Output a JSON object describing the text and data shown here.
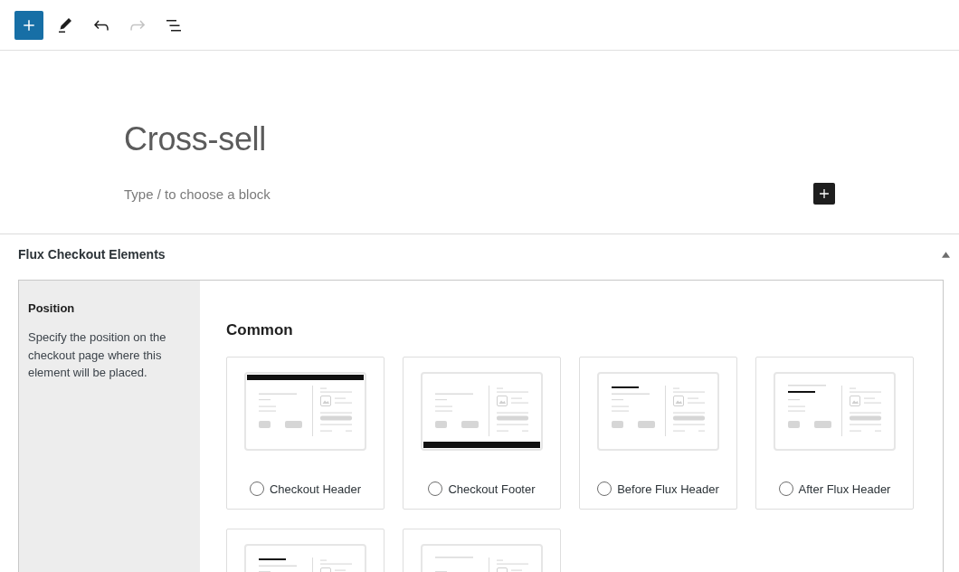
{
  "toolbar": [
    {
      "kind": "add",
      "disabled": false
    },
    {
      "kind": "edit",
      "disabled": false
    },
    {
      "kind": "undo",
      "disabled": false
    },
    {
      "kind": "redo",
      "disabled": true
    },
    {
      "kind": "list",
      "disabled": false
    }
  ],
  "editor": {
    "title": "Cross-sell",
    "placeholder": "Type / to choose a block"
  },
  "metabox": {
    "title": "Flux Checkout Elements",
    "expanded": true,
    "field": {
      "label": "Position",
      "description": "Specify the position on the checkout page where this element will be placed."
    },
    "groups": [
      {
        "heading": "Common",
        "options": [
          {
            "label": "Checkout Header",
            "kind": "header",
            "selected": false
          },
          {
            "label": "Checkout Footer",
            "kind": "footer",
            "selected": false
          },
          {
            "label": "Before Flux Header",
            "kind": "above",
            "selected": false
          },
          {
            "label": "After Flux Header",
            "kind": "below",
            "selected": false
          },
          {
            "kind": "above"
          },
          {
            "kind": "plain"
          }
        ]
      }
    ]
  }
}
